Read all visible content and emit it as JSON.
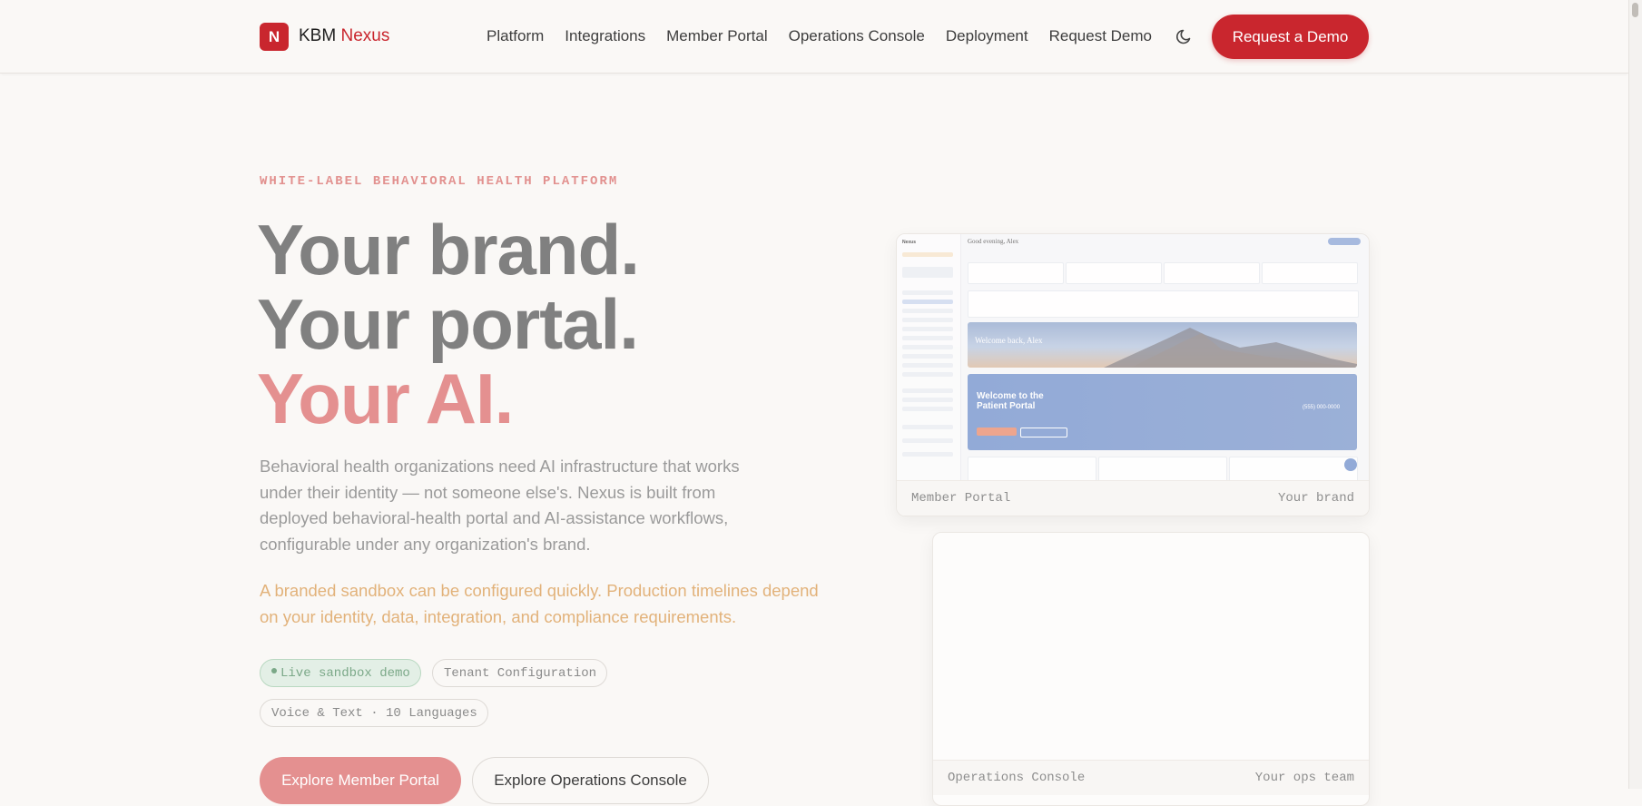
{
  "header": {
    "logo_letter": "N",
    "brand_prefix": "KBM",
    "brand_accent": "Nexus",
    "nav": [
      "Platform",
      "Integrations",
      "Member Portal",
      "Operations Console",
      "Deployment",
      "Request Demo"
    ],
    "theme_toggle_icon": "moon-icon",
    "cta_label": "Request a Demo"
  },
  "hero": {
    "eyebrow": "WHITE-LABEL BEHAVIORAL HEALTH PLATFORM",
    "headline": [
      "Your brand.",
      "Your portal.",
      "Your AI."
    ],
    "lead": "Behavioral health organizations need AI infrastructure that works under their identity — not someone else's. Nexus is built from deployed behavioral-health portal and AI-assistance workflows, configurable under any organization's brand.",
    "note": "A branded sandbox can be configured quickly. Production timelines depend on your identity, data, integration, and compliance requirements.",
    "chips": [
      "Live sandbox demo",
      "Tenant Configuration",
      "Voice & Text · 10 Languages"
    ],
    "primary_button": "Explore Member Portal",
    "secondary_button": "Explore Operations Console"
  },
  "cards": {
    "portal": {
      "label": "Member Portal",
      "tag": "Your brand",
      "screenshot": {
        "sidebar_brand": "Nexus",
        "greeting": "Good evening, Alex",
        "banner_text": "Welcome back, Alex",
        "portal_title": "Welcome to the Patient Portal",
        "phone": "(555) 000-0000"
      }
    },
    "ops": {
      "label": "Operations Console",
      "tag": "Your ops team"
    }
  },
  "colors": {
    "brand_red": "#c9262e",
    "background": "#faf8f6",
    "headline_gray": "#808080",
    "headline_accent": "#e49090",
    "note_amber": "#e2b27a",
    "live_green": "#7ba888"
  }
}
